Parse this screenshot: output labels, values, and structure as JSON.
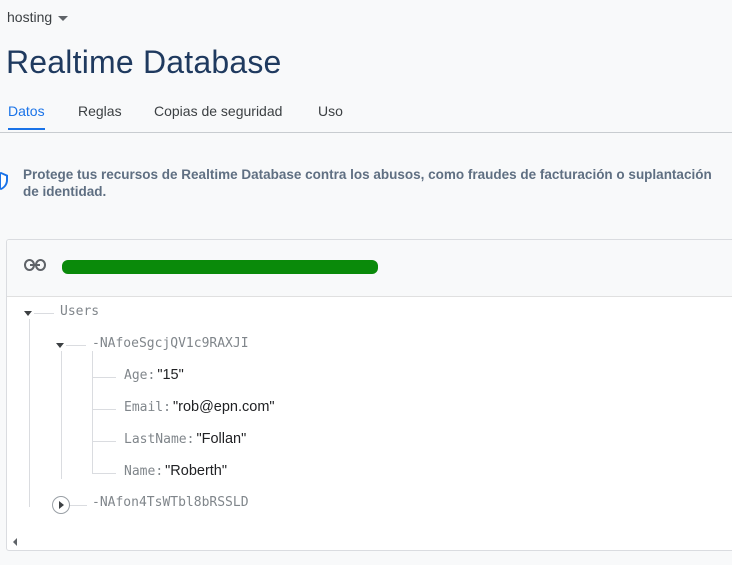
{
  "project": {
    "name": "hosting"
  },
  "page": {
    "title": "Realtime Database"
  },
  "tabs": [
    {
      "label": "Datos",
      "active": true
    },
    {
      "label": "Reglas",
      "active": false
    },
    {
      "label": "Copias de seguridad",
      "active": false
    },
    {
      "label": "Uso",
      "active": false
    }
  ],
  "notice": {
    "text": "Protege tus recursos de Realtime Database contra los abusos, como fraudes de facturación o suplantación de identidad."
  },
  "tree": {
    "root": "Users",
    "child1": "-NAfoeSgcjQV1c9RAXJI",
    "fields": [
      {
        "key": "Age",
        "value": "\"15\""
      },
      {
        "key": "Email",
        "value": "\"rob@epn.com\""
      },
      {
        "key": "LastName",
        "value": "\"Follan\""
      },
      {
        "key": "Name",
        "value": "\"Roberth\""
      }
    ],
    "child2": "-NAfon4TsWTbl8bRSSLD"
  },
  "colors": {
    "accent": "#1a73e8",
    "redaction": "#0a8a0a"
  }
}
